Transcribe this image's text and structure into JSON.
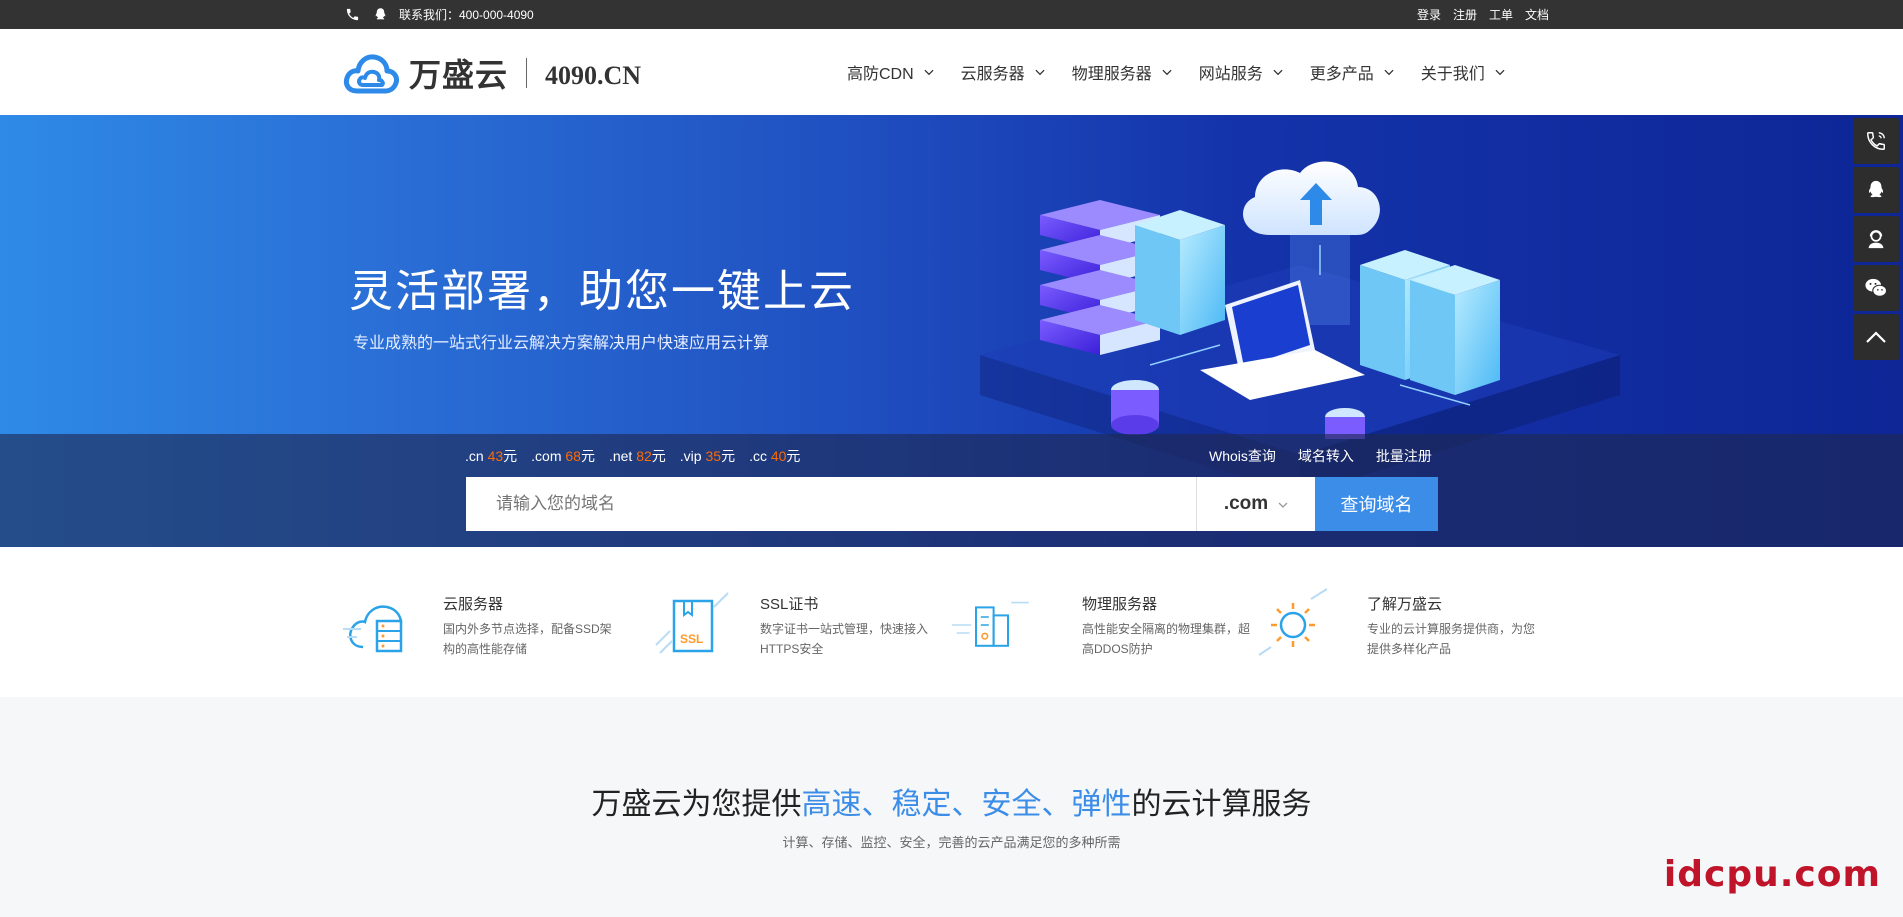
{
  "topbar": {
    "contact_label": "联系我们：400-000-4090",
    "links": [
      "登录",
      "注册",
      "工单",
      "文档"
    ]
  },
  "header": {
    "logo_cn": "万盛云",
    "logo_domain": "4090.CN",
    "nav": [
      "高防CDN",
      "云服务器",
      "物理服务器",
      "网站服务",
      "更多产品",
      "关于我们"
    ]
  },
  "banner": {
    "title": "灵活部署，助您一键上云",
    "subtitle": "专业成熟的一站式行业云解决方案解决用户快速应用云计算"
  },
  "domain_search": {
    "prices": [
      {
        "tld": ".cn",
        "price": "43",
        "unit": "元"
      },
      {
        "tld": ".com",
        "price": "68",
        "unit": "元"
      },
      {
        "tld": ".net",
        "price": "82",
        "unit": "元"
      },
      {
        "tld": ".vip",
        "price": "35",
        "unit": "元"
      },
      {
        "tld": ".cc",
        "price": "40",
        "unit": "元"
      }
    ],
    "quick_links": [
      "Whois查询",
      "域名转入",
      "批量注册"
    ],
    "placeholder": "请输入您的域名",
    "selected_tld": ".com",
    "button_label": "查询域名"
  },
  "features": [
    {
      "title": "云服务器",
      "desc": "国内外多节点选择，配备SSD架构的高性能存储"
    },
    {
      "title": "SSL证书",
      "desc": "数字证书一站式管理，快速接入HTTPS安全"
    },
    {
      "title": "物理服务器",
      "desc": "高性能安全隔离的物理集群，超高DDOS防护"
    },
    {
      "title": "了解万盛云",
      "desc": "专业的云计算服务提供商，为您提供多样化产品"
    }
  ],
  "services": {
    "heading_prefix": "万盛云为您提供",
    "heading_highlight": "高速、稳定、安全、弹性",
    "heading_suffix": "的云计算服务",
    "desc": "计算、存储、监控、安全，完善的云产品满足您的多种所需"
  },
  "watermark": "idcpu.com",
  "colors": {
    "accent": "#3b8de8",
    "price": "#ff6a00",
    "topbar": "#333333",
    "watermark": "#c0142b"
  }
}
